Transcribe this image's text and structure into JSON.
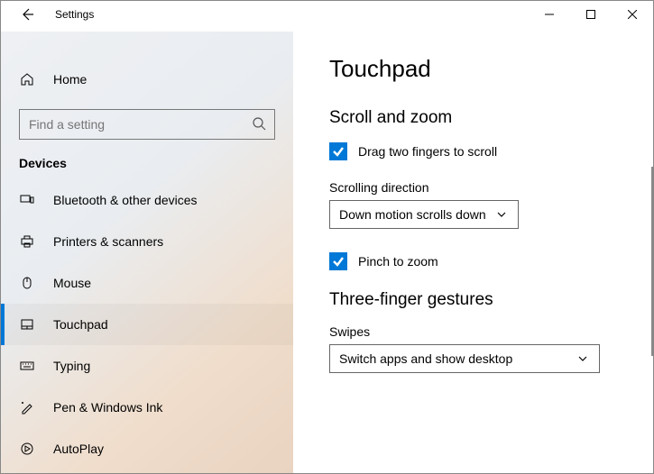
{
  "window": {
    "title": "Settings"
  },
  "sidebar": {
    "home_label": "Home",
    "search_placeholder": "Find a setting",
    "section_label": "Devices",
    "items": [
      {
        "label": "Bluetooth & other devices"
      },
      {
        "label": "Printers & scanners"
      },
      {
        "label": "Mouse"
      },
      {
        "label": "Touchpad"
      },
      {
        "label": "Typing"
      },
      {
        "label": "Pen & Windows Ink"
      },
      {
        "label": "AutoPlay"
      }
    ]
  },
  "main": {
    "page_title": "Touchpad",
    "scroll_zoom_heading": "Scroll and zoom",
    "drag_scroll_label": "Drag two fingers to scroll",
    "scrolling_direction_label": "Scrolling direction",
    "scrolling_direction_value": "Down motion scrolls down",
    "pinch_zoom_label": "Pinch to zoom",
    "three_finger_heading": "Three-finger gestures",
    "swipes_label": "Swipes",
    "swipes_value": "Switch apps and show desktop"
  }
}
